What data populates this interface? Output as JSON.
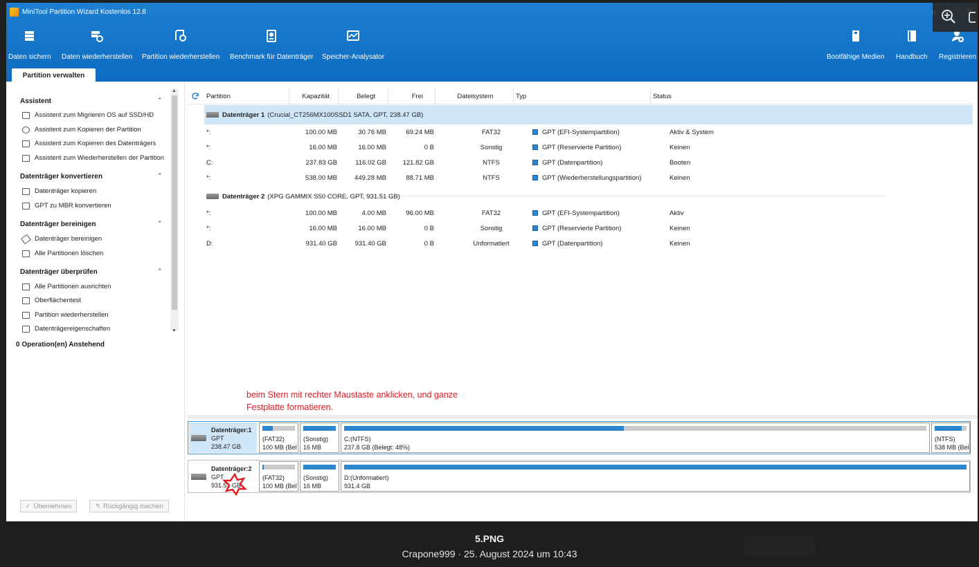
{
  "window": {
    "title": "MiniTool Partition Wizard Kostenlos 12.8"
  },
  "toolbar": {
    "left": [
      {
        "label": "Daten sichern",
        "icon": "backup-icon"
      },
      {
        "label": "Daten wiederherstellen",
        "icon": "data-recovery-icon"
      },
      {
        "label": "Partition wiederherstellen",
        "icon": "partition-recovery-icon"
      },
      {
        "label": "Benchmark für Datenträger",
        "icon": "benchmark-icon"
      },
      {
        "label": "Speicher-Analysator",
        "icon": "space-analyzer-icon"
      }
    ],
    "right": [
      {
        "label": "Bootfähige Medien",
        "icon": "bootable-media-icon"
      },
      {
        "label": "Handbuch",
        "icon": "manual-icon"
      },
      {
        "label": "Registrieren",
        "icon": "register-icon"
      }
    ]
  },
  "tab": {
    "label": "Partition verwalten"
  },
  "sidebar": {
    "sections": [
      {
        "title": "Assistent",
        "items": [
          "Assistent zum Migrieren OS auf SSD/HD",
          "Assistent zum Kopieren der Partition",
          "Assistent zum Kopieren des Datenträgers",
          "Assistent zum Wiederherstellen der Partition"
        ]
      },
      {
        "title": "Datenträger konvertieren",
        "items": [
          "Datenträger kopieren",
          "GPT zu MBR konvertieren"
        ]
      },
      {
        "title": "Datenträger bereinigen",
        "items": [
          "Datenträger bereinigen",
          "Alle Partitionen löschen"
        ]
      },
      {
        "title": "Datenträger überprüfen",
        "items": [
          "Alle Partitionen ausrichten",
          "Oberflächentest",
          "Partition wiederherstellen",
          "Datenträgereigenschaften"
        ]
      }
    ],
    "pending": "0 Operation(en) Anstehend",
    "apply_label": "Übernehmen",
    "undo_label": "Rückgängig machen"
  },
  "table": {
    "columns": [
      "Partition",
      "Kapazität",
      "Belegt",
      "Frei",
      "Dateisystem",
      "Typ",
      "Status"
    ],
    "disks": [
      {
        "name": "Datenträger 1",
        "info": "(Crucial_CT256MX100SSD1 SATA, GPT, 238.47 GB)",
        "partitions": [
          {
            "partition": "*:",
            "capacity": "100.00 MB",
            "used": "30.76 MB",
            "free": "69.24 MB",
            "fs": "FAT32",
            "type": "GPT (EFI-Systempartition)",
            "status": "Aktiv & System"
          },
          {
            "partition": "*:",
            "capacity": "16.00 MB",
            "used": "16.00 MB",
            "free": "0 B",
            "fs": "Sonstig",
            "type": "GPT (Reservierte Partition)",
            "status": "Keinen"
          },
          {
            "partition": "C:",
            "capacity": "237.83 GB",
            "used": "116.02 GB",
            "free": "121.82 GB",
            "fs": "NTFS",
            "type": "GPT (Datenpartition)",
            "status": "Booten"
          },
          {
            "partition": "*:",
            "capacity": "538.00 MB",
            "used": "449.28 MB",
            "free": "88.71 MB",
            "fs": "NTFS",
            "type": "GPT (Wiederherstellungspartition)",
            "status": "Keinen"
          }
        ]
      },
      {
        "name": "Datenträger 2",
        "info": "(XPG GAMMIX S50 CORE, GPT, 931.51 GB)",
        "partitions": [
          {
            "partition": "*:",
            "capacity": "100.00 MB",
            "used": "4.00 MB",
            "free": "96.00 MB",
            "fs": "FAT32",
            "type": "GPT (EFI-Systempartition)",
            "status": "Aktiv"
          },
          {
            "partition": "*:",
            "capacity": "16.00 MB",
            "used": "16.00 MB",
            "free": "0 B",
            "fs": "Sonstig",
            "type": "GPT (Reservierte Partition)",
            "status": "Keinen"
          },
          {
            "partition": "D:",
            "capacity": "931.40 GB",
            "used": "931.40 GB",
            "free": "0 B",
            "fs": "Unformatiert",
            "type": "GPT (Datenpartition)",
            "status": "Keinen"
          }
        ]
      }
    ]
  },
  "annotation": {
    "text": "beim Stern mit rechter Maustaste anklicken, und ganze Festplatte formatieren."
  },
  "disk_map": [
    {
      "name": "Datenträger:1",
      "style": "GPT",
      "size": "238.47 GB",
      "parts": [
        {
          "l1": "(FAT32)",
          "l2": "100 MB (Bel",
          "fill": 0.31
        },
        {
          "l1": "(Sonstig)",
          "l2": "16 MB",
          "fill": 1.0
        },
        {
          "l1": "C:(NTFS)",
          "l2": "237.8 GB (Belegt: 48%)",
          "fill": 0.48
        },
        {
          "l1": "(NTFS)",
          "l2": "538 MB (Bel",
          "fill": 0.84
        }
      ]
    },
    {
      "name": "Datenträger:2",
      "style": "GPT",
      "size": "931.51 GB",
      "parts": [
        {
          "l1": "(FAT32)",
          "l2": "100 MB (Bel",
          "fill": 0.04
        },
        {
          "l1": "(Sonstig)",
          "l2": "16 MB",
          "fill": 1.0
        },
        {
          "l1": "D:(Unformatiert)",
          "l2": "931.4 GB",
          "fill": 1.0
        }
      ]
    }
  ],
  "caption": {
    "title": "5.PNG",
    "subtitle": "Crapone999 · 25. August 2024 um 10:43"
  },
  "colors": {
    "header_blue": "#1d7fd0",
    "selection": "#cfe6f8",
    "partition_fill": "#2d86d0",
    "annotation_red": "#e0191f"
  }
}
